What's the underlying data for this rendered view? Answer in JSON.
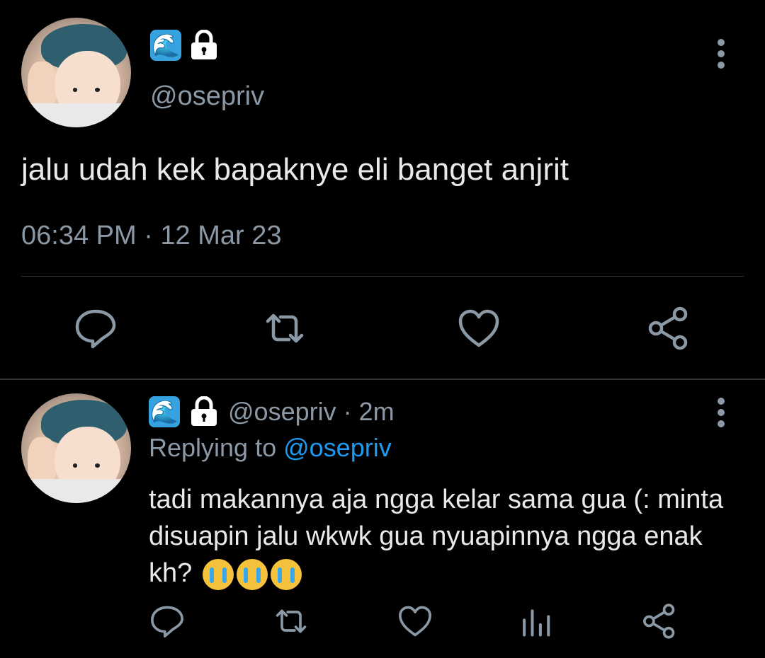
{
  "main_tweet": {
    "name_icons": [
      "wave-emoji",
      "lock-icon"
    ],
    "wave_glyph": "🌊",
    "handle": "@osepriv",
    "text": "jalu udah kek bapaknye eli banget anjrit",
    "timestamp": "06:34 PM · 12 Mar 23",
    "actions": [
      "reply-icon",
      "retweet-icon",
      "like-icon",
      "share-icon"
    ]
  },
  "reply_tweet": {
    "name_icons": [
      "wave-emoji",
      "lock-icon"
    ],
    "handle_time": "@osepriv · 2m",
    "replying_prefix": "Replying to ",
    "replying_mention": "@osepriv",
    "text": "tadi makannya aja ngga kelar sama gua (: minta disuapin jalu wkwk gua nyuapinnya ngga enak kh?",
    "emojis": [
      "loudly-crying-face",
      "loudly-crying-face",
      "loudly-crying-face"
    ],
    "actions": [
      "reply-icon",
      "retweet-icon",
      "like-icon",
      "analytics-icon",
      "share-icon"
    ]
  },
  "colors": {
    "background": "#000000",
    "text": "#e7e9ea",
    "muted": "#8b98a5",
    "link": "#1d9bf0",
    "divider": "#2f3336"
  }
}
